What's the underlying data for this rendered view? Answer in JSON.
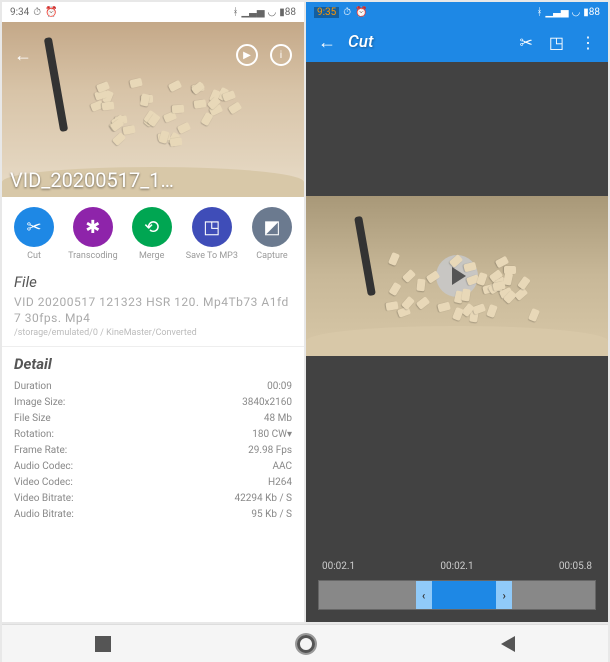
{
  "left": {
    "status": {
      "time": "9:34",
      "icons": [
        "alarm",
        "clock"
      ]
    },
    "top_icons": {
      "play": "play-icon",
      "info": "info-icon"
    },
    "video_title": "VID_20200517_1…",
    "actions": [
      {
        "label": "Cut",
        "color": "c-blue",
        "icon": "scissors"
      },
      {
        "label": "Transcoding",
        "color": "c-purple",
        "icon": "compress"
      },
      {
        "label": "Merge",
        "color": "c-green",
        "icon": "link"
      },
      {
        "label": "Save To MP3",
        "color": "c-indigo",
        "icon": "disk"
      },
      {
        "label": "Capture",
        "color": "c-gray",
        "icon": "camera"
      }
    ],
    "file": {
      "section": "File",
      "name": "VID 20200517 121323 HSR 120. Mp4Tb73 A1fd7 30fps. Mp4",
      "path": "/storage/emulated/0 / KineMaster/Converted"
    },
    "detail": {
      "section": "Detail",
      "rows": [
        {
          "k": "Duration",
          "v": "00:09"
        },
        {
          "k": "Image Size:",
          "v": "3840x2160"
        },
        {
          "k": "File Size",
          "v": "48 Mb"
        },
        {
          "k": "Rotation:",
          "v": "180 CW▾"
        },
        {
          "k": "Frame Rate:",
          "v": "29.98 Fps"
        },
        {
          "k": "Audio Codec:",
          "v": "AAC"
        },
        {
          "k": "Video Codec:",
          "v": "H264"
        },
        {
          "k": "Video Bitrate:",
          "v": "42294 Kb / S"
        },
        {
          "k": "Audio Bitrate:",
          "v": "95 Kb / S"
        }
      ]
    }
  },
  "right": {
    "status": {
      "time": "9:35"
    },
    "appbar": {
      "title": "Cut"
    },
    "timeline": {
      "start": "00:02.1",
      "current": "00:02.1",
      "end": "00:05.8"
    }
  }
}
